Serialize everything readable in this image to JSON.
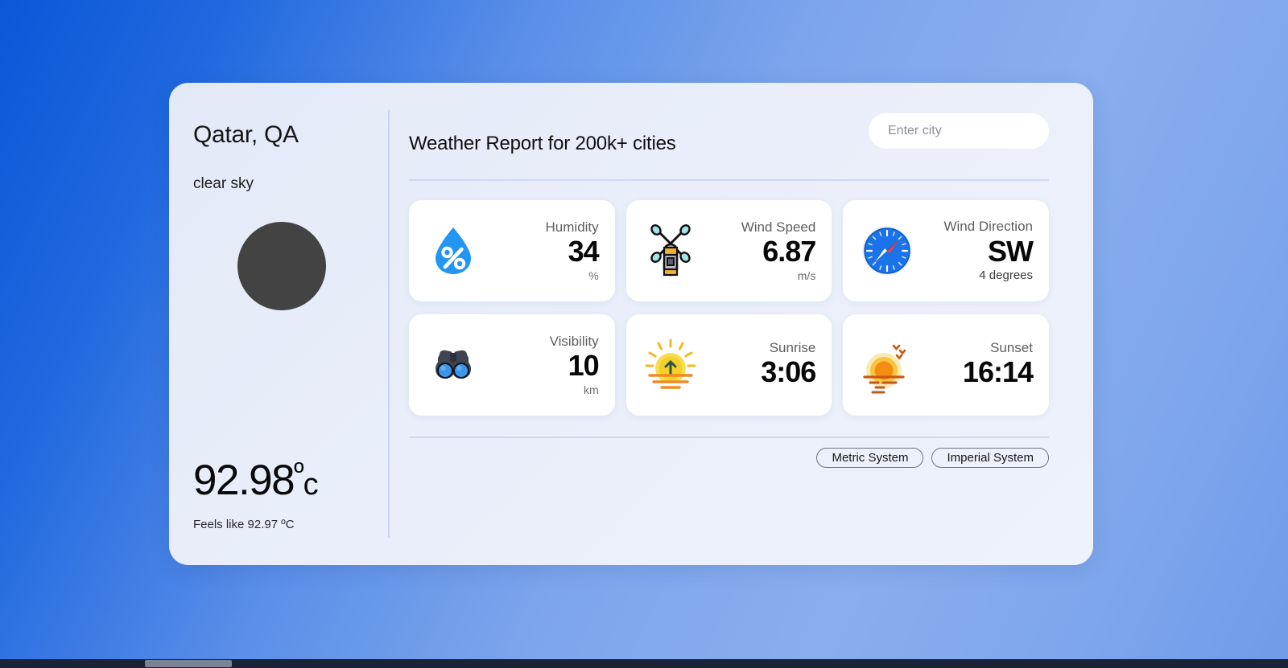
{
  "location": {
    "city_label": "Qatar, QA",
    "condition": "clear sky",
    "weather_icon": "cloud-placeholder-icon"
  },
  "temperature": {
    "value": "92.98",
    "degree_symbol": "º",
    "unit_letter": "c",
    "feels_like": "Feels like 92.97 ºC"
  },
  "header": {
    "title": "Weather Report for 200k+ cities"
  },
  "search": {
    "placeholder": "Enter city",
    "value": ""
  },
  "cards": [
    {
      "icon": "water-droplet-percent-icon",
      "label": "Humidity",
      "value": "34",
      "unit": "%"
    },
    {
      "icon": "anemometer-icon",
      "label": "Wind Speed",
      "value": "6.87",
      "unit": "m/s"
    },
    {
      "icon": "compass-icon",
      "label": "Wind Direction",
      "value": "SW",
      "unit": "4 degrees"
    },
    {
      "icon": "binoculars-icon",
      "label": "Visibility",
      "value": "10",
      "unit": "km"
    },
    {
      "icon": "sunrise-icon",
      "label": "Sunrise",
      "value": "3:06",
      "unit": ""
    },
    {
      "icon": "sunset-icon",
      "label": "Sunset",
      "value": "16:14",
      "unit": ""
    }
  ],
  "unit_system": {
    "metric_label": "Metric System",
    "imperial_label": "Imperial System"
  },
  "colors": {
    "background_blue_dark": "#0b57d6",
    "background_blue_light": "#89aeee",
    "panel": "#e9eefa",
    "card": "#ffffff",
    "droplet_blue": "#2196f3",
    "compass_blue": "#1a73e8",
    "sun_yellow": "#f5cf2b",
    "sunset_orange": "#f68b1f",
    "weather_icon_gray": "#434343"
  }
}
